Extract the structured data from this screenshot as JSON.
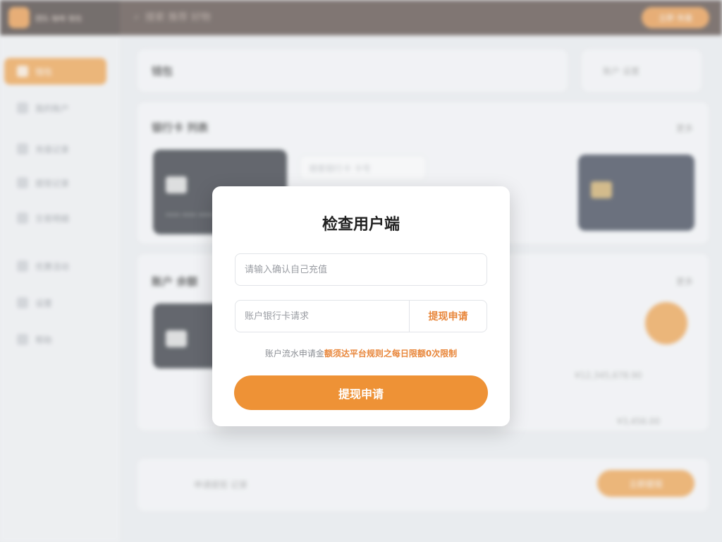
{
  "background": {
    "logo_text": "团队 咖啡 钱包",
    "top_search": "搜索 推荐 好物",
    "top_button": "立即 充值",
    "sidebar": [
      {
        "label": "钱包",
        "icon": "wallet-icon"
      },
      {
        "label": "我的账户",
        "icon": "user-icon"
      },
      {
        "label": "充值记录",
        "icon": "list-icon"
      },
      {
        "label": "提现记录",
        "icon": "record-icon"
      },
      {
        "label": "交易明细",
        "icon": "detail-icon"
      },
      {
        "label": "优惠活动",
        "icon": "gift-icon"
      },
      {
        "label": "设置",
        "icon": "gear-icon"
      },
      {
        "label": "帮助",
        "icon": "help-icon"
      }
    ],
    "header_title": "钱包",
    "header_right": "账户 设置",
    "section1_title": "银行卡 列表",
    "section1_right": "更多",
    "section1_input": "搜索银行卡 卡号",
    "section2_title": "账户 余额",
    "section2_right": "更多",
    "amount_text": "¥12,345,678.90",
    "amount_text_2": "¥3,456.00",
    "bottom_label": "申请提现 记录",
    "bottom_button": "立即提现",
    "card_number": "**** **** **** 8888"
  },
  "modal": {
    "title": "检查用户端",
    "field1_placeholder": "请输入确认自己充值",
    "field2_placeholder": "账户银行卡请求",
    "field2_action": "提现申请",
    "hint_prefix": "账户流水申请金",
    "hint_highlight": "额须达平台规则之每日限额0次限制",
    "submit_label": "提现申请"
  },
  "colors": {
    "accent": "#ee9236",
    "topbar": "#4a3a34",
    "link": "#e8863a"
  }
}
